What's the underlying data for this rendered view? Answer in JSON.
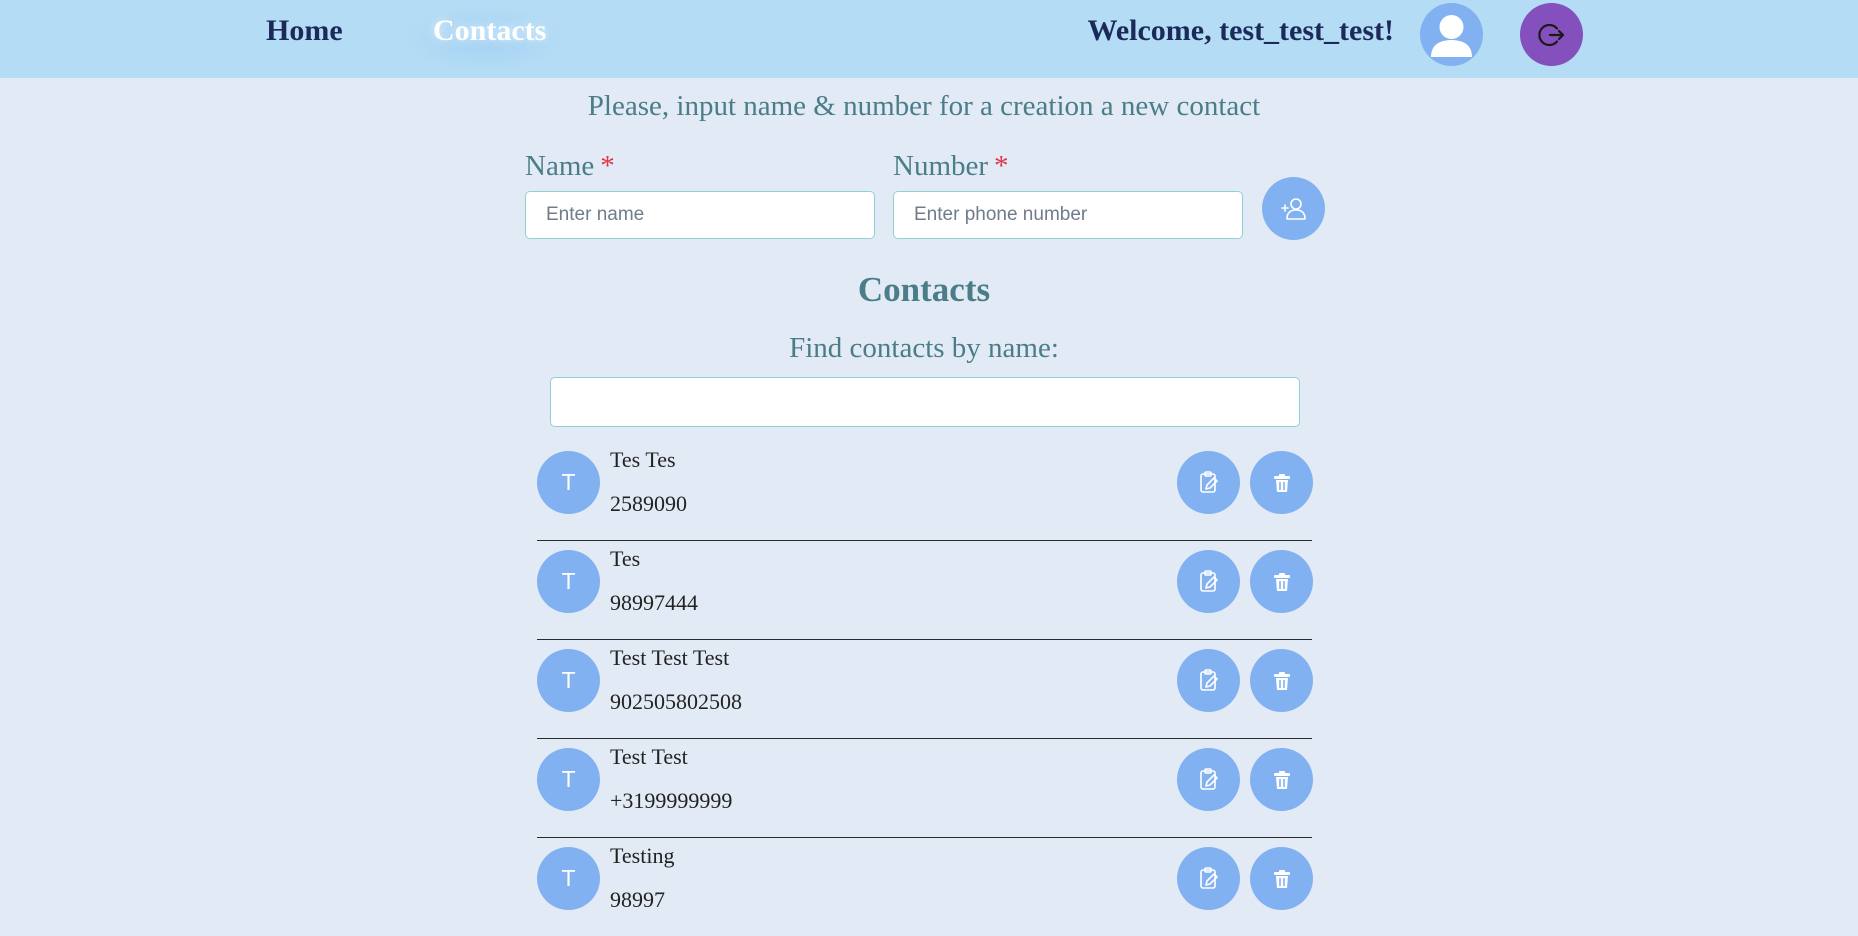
{
  "nav": {
    "home": "Home",
    "contacts": "Contacts"
  },
  "header": {
    "welcome": "Welcome, test_test_test!",
    "avatar_icon": "user-avatar-icon",
    "logout_icon": "logout-icon"
  },
  "form": {
    "prompt": "Please, input name & number for a creation a new contact",
    "name_label": "Name",
    "number_label": "Number",
    "required_mark": "*",
    "name_placeholder": "Enter name",
    "number_placeholder": "Enter phone number",
    "name_value": "",
    "number_value": "",
    "add_icon": "add-user-icon"
  },
  "contacts": {
    "title": "Contacts",
    "find_label": "Find contacts by name:",
    "search_value": "",
    "items": [
      {
        "initial": "T",
        "name": "Tes Tes",
        "phone": "2589090"
      },
      {
        "initial": "T",
        "name": "Tes",
        "phone": "98997444"
      },
      {
        "initial": "T",
        "name": "Test Test Test",
        "phone": "902505802508"
      },
      {
        "initial": "T",
        "name": "Test Test",
        "phone": "+3199999999"
      },
      {
        "initial": "T",
        "name": "Testing",
        "phone": "98997"
      }
    ]
  },
  "colors": {
    "header_bg": "#b4dcf4",
    "page_bg": "#e2ebf5",
    "accent": "#82b1f2",
    "logout": "#8450be",
    "heading_text": "#4b7d88",
    "nav_text": "#1b2a5a",
    "required": "#e0334a"
  }
}
